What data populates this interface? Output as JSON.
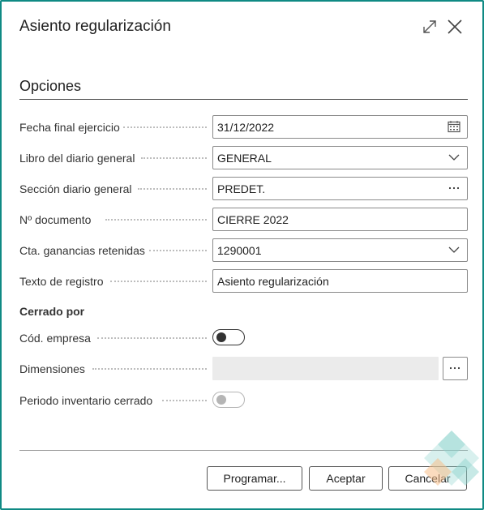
{
  "dialog": {
    "title": "Asiento regularización",
    "expand_icon": "expand-icon",
    "close_icon": "close-icon"
  },
  "section": {
    "title": "Opciones"
  },
  "fields": [
    {
      "label": "Fecha final ejercicio",
      "value": "31/12/2022",
      "icon": "calendar-icon"
    },
    {
      "label": "Libro del diario general",
      "value": "GENERAL",
      "icon": "chevron-down-icon"
    },
    {
      "label": "Sección diario general",
      "value": "PREDET.",
      "icon": "ellipsis-icon"
    },
    {
      "label": "Nº documento",
      "value": "CIERRE 2022"
    },
    {
      "label": "Cta. ganancias retenidas",
      "value": "1290001",
      "icon": "chevron-down-icon"
    },
    {
      "label": "Texto de registro",
      "value": "Asiento regularización"
    }
  ],
  "closed_by": {
    "title": "Cerrado por",
    "company_code": {
      "label": "Cód. empresa",
      "on": false
    },
    "dimensions": {
      "label": "Dimensiones",
      "value": "",
      "button_icon": "ellipsis-icon"
    },
    "inventory_period": {
      "label": "Periodo inventario cerrado",
      "on": false,
      "disabled": true
    }
  },
  "buttons": {
    "schedule": "Programar...",
    "ok": "Aceptar",
    "cancel": "Cancelar"
  },
  "colors": {
    "border": "#0f8a84",
    "watermark_teal": "#8fd3cd",
    "watermark_orange": "#f7c08a"
  }
}
